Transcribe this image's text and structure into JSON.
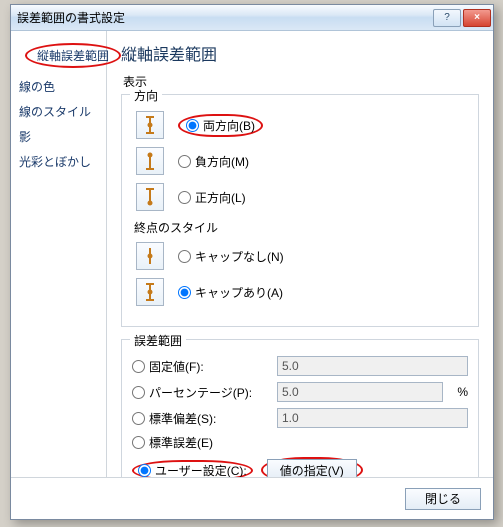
{
  "window": {
    "title": "誤差範囲の書式設定",
    "help": "?",
    "close": "×"
  },
  "sidebar": {
    "items": [
      {
        "label": "縦軸誤差範囲"
      },
      {
        "label": "線の色"
      },
      {
        "label": "線のスタイル"
      },
      {
        "label": "影"
      },
      {
        "label": "光彩とぼかし"
      }
    ]
  },
  "content": {
    "heading": "縦軸誤差範囲",
    "display_label": "表示",
    "direction": {
      "legend": "方向",
      "options": {
        "both": "両方向(B)",
        "minus": "負方向(M)",
        "plus": "正方向(L)"
      }
    },
    "endstyle": {
      "legend": "終点のスタイル",
      "options": {
        "none": "キャップなし(N)",
        "cap": "キャップあり(A)"
      }
    },
    "error": {
      "legend": "誤差範囲",
      "fixed_label": "固定値(F):",
      "fixed_value": "5.0",
      "percent_label": "パーセンテージ(P):",
      "percent_value": "5.0",
      "percent_unit": "%",
      "stddev_label": "標準偏差(S):",
      "stddev_value": "1.0",
      "stderr_label": "標準誤差(E)",
      "user_label": "ユーザー設定(C):",
      "specify_btn": "値の指定(V)"
    }
  },
  "footer": {
    "close_btn": "閉じる"
  }
}
